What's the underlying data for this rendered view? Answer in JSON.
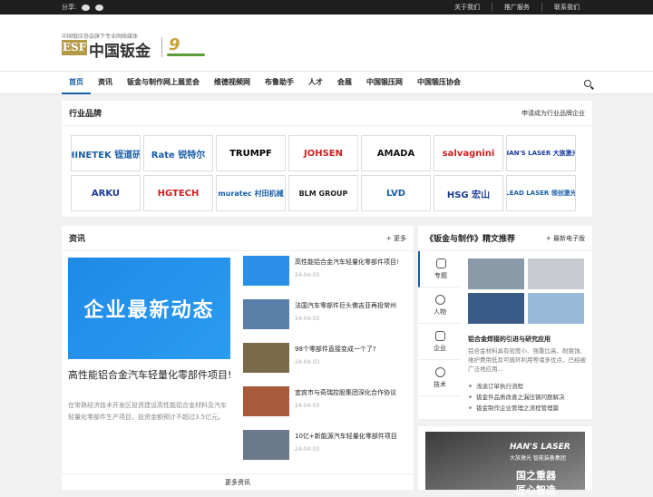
{
  "topbar": {
    "share_label": "分享:",
    "links": [
      "关于我们",
      "推广服务",
      "联系我们"
    ]
  },
  "logo": {
    "tagline": "中国锻压协会旗下专业网络媒体",
    "mark": "ESF",
    "name": "中国钣金",
    "nine": "9"
  },
  "nav": {
    "items": [
      "首页",
      "资讯",
      "钣金与制作网上展览会",
      "维德视频网",
      "布鲁助手",
      "人才",
      "会展",
      "中国锻压网",
      "中国锻压协会"
    ]
  },
  "brands": {
    "title": "行业品牌",
    "more": "申请成为行业品牌企业",
    "items": [
      {
        "name": "SHINETEK 锃道研磨",
        "color": "#1a5ea8"
      },
      {
        "name": "Rate 锐特尔",
        "color": "#1a5ea8"
      },
      {
        "name": "TRUMPF",
        "color": "#000000"
      },
      {
        "name": "JOHSEN",
        "color": "#cc2222"
      },
      {
        "name": "AMADA",
        "color": "#111111"
      },
      {
        "name": "salvagnini",
        "color": "#cc2222"
      },
      {
        "name": "HAN'S LASER 大族激光",
        "color": "#1a3a9a"
      },
      {
        "name": "ARKU",
        "color": "#1a3a9a"
      },
      {
        "name": "HGTECH",
        "color": "#cc2222"
      },
      {
        "name": "muratec 村田机械",
        "color": "#1a5ea8"
      },
      {
        "name": "BLM GROUP",
        "color": "#222222"
      },
      {
        "name": "LVD",
        "color": "#1a5ea8"
      },
      {
        "name": "HSG 宏山",
        "color": "#1a3a9a"
      },
      {
        "name": "LEAD LASER 领创激光",
        "color": "#1a5ea8"
      }
    ]
  },
  "news": {
    "title": "资讯",
    "more": "+ 更多",
    "feature": {
      "image_text": "企业最新动态",
      "title": "高性能铝合金汽车轻量化零部件项目!",
      "desc": "在常熟经济技术开发区投资建设高性能铝合金材料及汽车轻量化零部件生产项目，投资金额预计不超过3.5亿元。",
      "date": "24-04-03"
    },
    "items": [
      {
        "title": "高性能铝合金汽车轻量化零部件项目!",
        "date": "24-04-03",
        "thumb": "#2b8fe8"
      },
      {
        "title": "法国汽车零部件巨头佛吉亚再投常州",
        "date": "24-04-03",
        "thumb": "#5a7fa8"
      },
      {
        "title": "98个零部件直接变成一个了?",
        "date": "24-04-03",
        "thumb": "#7a6a4a"
      },
      {
        "title": "宜宾市与奇瑞控股集团深化合作协议",
        "date": "24-04-03",
        "thumb": "#a85a3a"
      },
      {
        "title": "10亿+新能源汽车轻量化零部件项目",
        "date": "24-04-03",
        "thumb": "#6a7a8a"
      }
    ],
    "bottom_more": "更多资讯"
  },
  "magazine": {
    "title": "《钣金与制作》精文推荐",
    "more": "+ 最新电子版",
    "tabs": [
      "专题",
      "人物",
      "企业",
      "技术"
    ],
    "article_title": "铝合金焊接的引进与研究应用",
    "desc": "铝合金材料具有密度小、强重比高、耐腐蚀、维护费用低及可循环利用等诸多优点，已经被广泛地应用...",
    "bullets": [
      "浅谈订单执行流程",
      "钣金件品质改善之漏压钢问题解决",
      "钣金制作企业管理之流程管理篇"
    ],
    "imgs": [
      "#8a9aa8",
      "#c8ccd0",
      "#3a5a88",
      "#9ab8d8"
    ]
  },
  "ad": {
    "line1": "HAN'S LASER",
    "line2": "大族激光 智能装备集团",
    "line3": "国之重器",
    "line4": "匠心智造"
  }
}
